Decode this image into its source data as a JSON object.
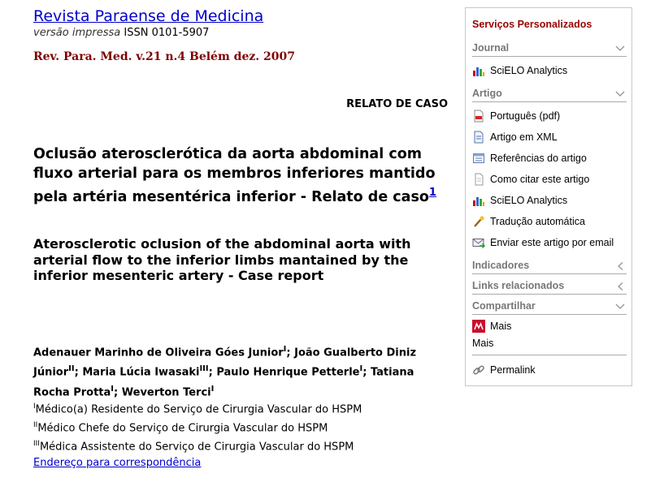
{
  "journal": {
    "title": "Revista Paraense de Medicina",
    "version": "versão impressa",
    "issn": "ISSN 0101-5907",
    "issue": "Rev. Para. Med. v.21 n.4 Belém dez. 2007"
  },
  "article": {
    "section": "RELATO DE CASO",
    "title_pt": "Oclusão aterosclerótica da aorta abdominal com fluxo arterial para os membros inferiores mantido pela artéria mesentérica inferior - Relato de caso",
    "title_pt_footnote": "1",
    "title_en": "Aterosclerotic oclusion of the abdominal aorta with arterial flow to the inferior limbs mantained by the inferior mesenteric artery - Case report",
    "authors": [
      {
        "name": "Adenauer Marinho de Oliveira Góes Junior",
        "sup": "I"
      },
      {
        "name": "João Gualberto Diniz Júnior",
        "sup": "II"
      },
      {
        "name": "Maria Lúcia Iwasaki",
        "sup": "III"
      },
      {
        "name": "Paulo Henrique Petterle",
        "sup": "I"
      },
      {
        "name": "Tatiana Rocha Protta",
        "sup": "I"
      },
      {
        "name": "Weverton Terci",
        "sup": "I"
      }
    ],
    "affiliations": [
      {
        "sup": "I",
        "text": "Médico(a) Residente do Serviço de Cirurgia Vascular do HSPM"
      },
      {
        "sup": "II",
        "text": "Médico Chefe do Serviço de Cirurgia Vascular do HSPM"
      },
      {
        "sup": "III",
        "text": "Médica Assistente do Serviço de Cirurgia Vascular do HSPM"
      }
    ],
    "correspondence_link": "Endereço para correspondência"
  },
  "sidebar": {
    "title": "Serviços Personalizados",
    "journal_section": "Journal",
    "journal_items": [
      "SciELO Analytics"
    ],
    "artigo_section": "Artigo",
    "artigo_items": [
      {
        "label": "Português (pdf)",
        "icon": "pdf-icon"
      },
      {
        "label": "Artigo em XML",
        "icon": "xml-icon"
      },
      {
        "label": "Referências do artigo",
        "icon": "references-icon"
      },
      {
        "label": "Como citar este artigo",
        "icon": "cite-icon"
      },
      {
        "label": "SciELO Analytics",
        "icon": "analytics-icon"
      },
      {
        "label": "Tradução automática",
        "icon": "translate-icon"
      },
      {
        "label": "Enviar este artigo por email",
        "icon": "email-icon"
      }
    ],
    "indicadores": "Indicadores",
    "links_relacionados": "Links relacionados",
    "compartilhar": "Compartilhar",
    "share_items": [
      "Mais",
      "Mais"
    ],
    "permalink": "Permalink"
  }
}
